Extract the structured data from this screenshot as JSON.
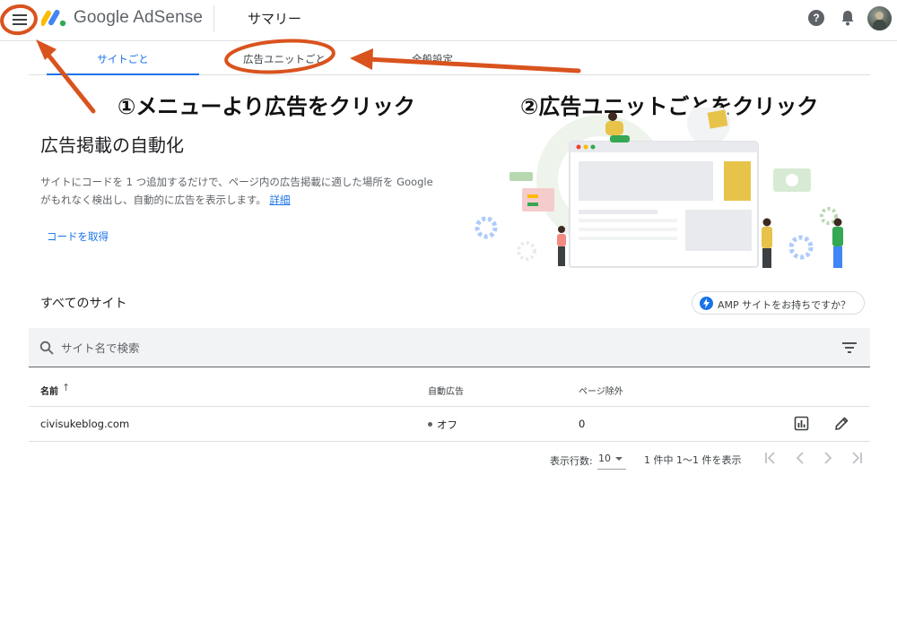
{
  "header": {
    "brand": "Google AdSense",
    "page_title": "サマリー",
    "help_icon_glyph": "?"
  },
  "tabs": [
    {
      "label": "サイトごと",
      "active": true
    },
    {
      "label": "広告ユニットごと",
      "active": false
    },
    {
      "label": "全般設定",
      "active": false
    }
  ],
  "annotations": {
    "step1": "①メニューより広告をクリック",
    "step2": "②広告ユニットごとをクリック",
    "color": "#d9531e"
  },
  "auto_ads": {
    "title": "広告掲載の自動化",
    "description": "サイトにコードを 1 つ追加するだけで、ページ内の広告掲載に適した場所を Google がもれなく検出し、自動的に広告を表示します。",
    "learn_more": "詳細",
    "get_code": "コードを取得"
  },
  "sites": {
    "title": "すべてのサイト",
    "amp_button": "AMP サイトをお持ちですか？",
    "search_placeholder": "サイト名で検索",
    "columns": {
      "name": "名前",
      "sort_indicator": "↑",
      "auto_ads": "自動広告",
      "excluded_pages": "ページ除外"
    },
    "rows": [
      {
        "site": "civisukeblog.com",
        "auto_ads": "オフ",
        "excluded_pages": "0"
      }
    ]
  },
  "pagination": {
    "rows_label": "表示行数:",
    "rows_value": "10",
    "info": "1 件中 1〜1 件を表示"
  },
  "icons": {
    "menu": "menu-icon",
    "help": "help-icon",
    "notifications": "bell-icon",
    "search": "search-icon",
    "filter": "filter-icon",
    "report": "bar-chart-icon",
    "edit": "pencil-icon",
    "amp": "lightning-icon"
  },
  "colors": {
    "accent": "#1a73e8",
    "annotation": "#d9531e"
  }
}
